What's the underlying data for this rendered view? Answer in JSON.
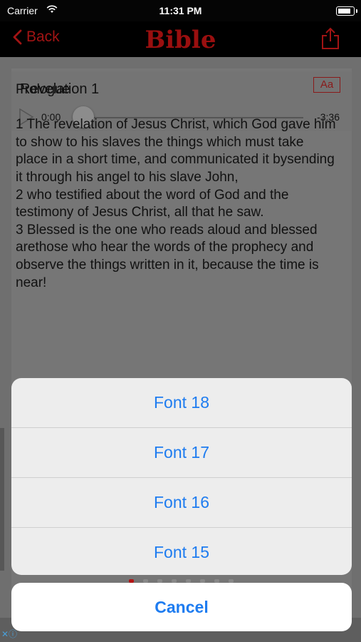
{
  "status_bar": {
    "carrier": "Carrier",
    "time": "11:31 PM",
    "battery_level": 0.9
  },
  "nav": {
    "back_label": "Back",
    "title": "Bible",
    "share_icon": "share-icon"
  },
  "chapter": {
    "title": "Revelation 1",
    "font_button": "Aa"
  },
  "player": {
    "elapsed": "0:00",
    "remaining": "-3:36",
    "progress": 0
  },
  "text": {
    "heading": "Prologue",
    "verses": [
      "1 The revelation of Jesus Christ, which God gave him to show to his slaves the things which must take place in a short time, and communicated it bysending it through his angel to his slave John,",
      "2 who testified about the word of God and the testimony of Jesus Christ, all that he saw.",
      "3 Blessed is the one who reads aloud and blessed arethose who hear the words of the prophecy and observe the things written in it, because the time is near!"
    ]
  },
  "action_sheet": {
    "options": [
      "Font 18",
      "Font 17",
      "Font 16",
      "Font 15"
    ],
    "cancel_label": "Cancel"
  },
  "colors": {
    "accent_red": "#b31414",
    "action_blue": "#1e7cf0"
  }
}
